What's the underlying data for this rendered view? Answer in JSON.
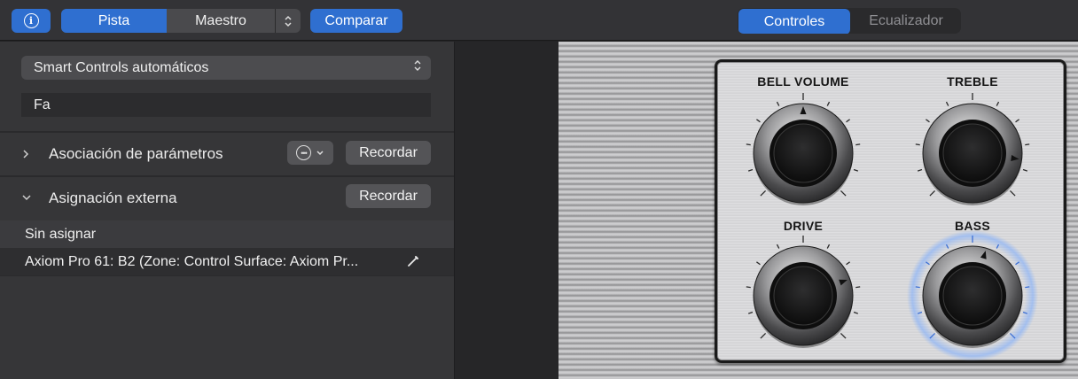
{
  "toolbar": {
    "info_icon": "info-icon",
    "pista": "Pista",
    "maestro": "Maestro",
    "stepper_icon": "up-down-chevron-icon",
    "comparar": "Comparar",
    "controles": "Controles",
    "ecualizador": "Ecualizador"
  },
  "inspector": {
    "smart_controls_value": "Smart Controls automáticos",
    "name_value": "Fa",
    "param_mapping": {
      "title": "Asociación de parámetros",
      "recall": "Recordar",
      "expanded": false
    },
    "external_assignment": {
      "title": "Asignación externa",
      "recall": "Recordar",
      "expanded": true
    },
    "assignments": [
      {
        "label": "Sin asignar"
      },
      {
        "label": "Axiom Pro 61: B2 (Zone: Control Surface: Axiom Pr..."
      }
    ]
  },
  "amp": {
    "knobs": [
      {
        "label": "BELL VOLUME",
        "value": 0.5,
        "highlighted": false
      },
      {
        "label": "TREBLE",
        "value": 0.86,
        "highlighted": false
      },
      {
        "label": "DRIVE",
        "value": 0.76,
        "highlighted": false
      },
      {
        "label": "BASS",
        "value": 0.56,
        "highlighted": true
      }
    ]
  },
  "colors": {
    "accent": "#2f6fd0",
    "panel": "#363638",
    "toolbar": "#333336"
  }
}
